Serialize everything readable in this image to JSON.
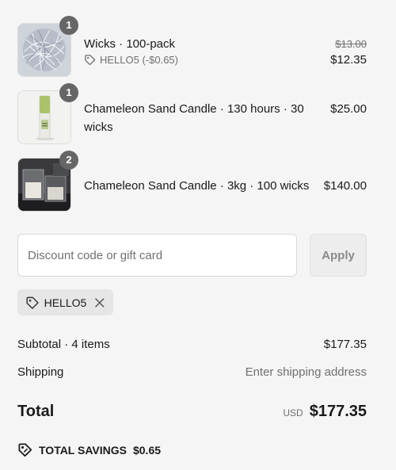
{
  "items": [
    {
      "name": "Wicks · 100-pack",
      "qty": "1",
      "original_price": "$13.00",
      "price": "$12.35",
      "discount_label": "HELLO5 (-$0.65)",
      "thumb_icon": "wicks-bundle-image"
    },
    {
      "name": "Chameleon Sand Candle · 130 hours · 30 wicks",
      "qty": "1",
      "price": "$25.00",
      "thumb_icon": "candle-tube-image"
    },
    {
      "name": "Chameleon Sand Candle · 3kg · 100 wicks",
      "qty": "2",
      "price": "$140.00",
      "thumb_icon": "candle-jars-image"
    }
  ],
  "discount": {
    "placeholder": "Discount code or gift card",
    "value": "",
    "apply_label": "Apply",
    "applied_code": "HELLO5"
  },
  "summary": {
    "subtotal_label": "Subtotal · 4 items",
    "subtotal_value": "$177.35",
    "shipping_label": "Shipping",
    "shipping_value": "Enter shipping address",
    "total_label": "Total",
    "currency": "USD",
    "total_value": "$177.35",
    "savings_label": "TOTAL SAVINGS",
    "savings_value": "$0.65"
  },
  "colors": {
    "badge": "#666666",
    "muted": "#707070",
    "background": "#f5f5f5"
  }
}
